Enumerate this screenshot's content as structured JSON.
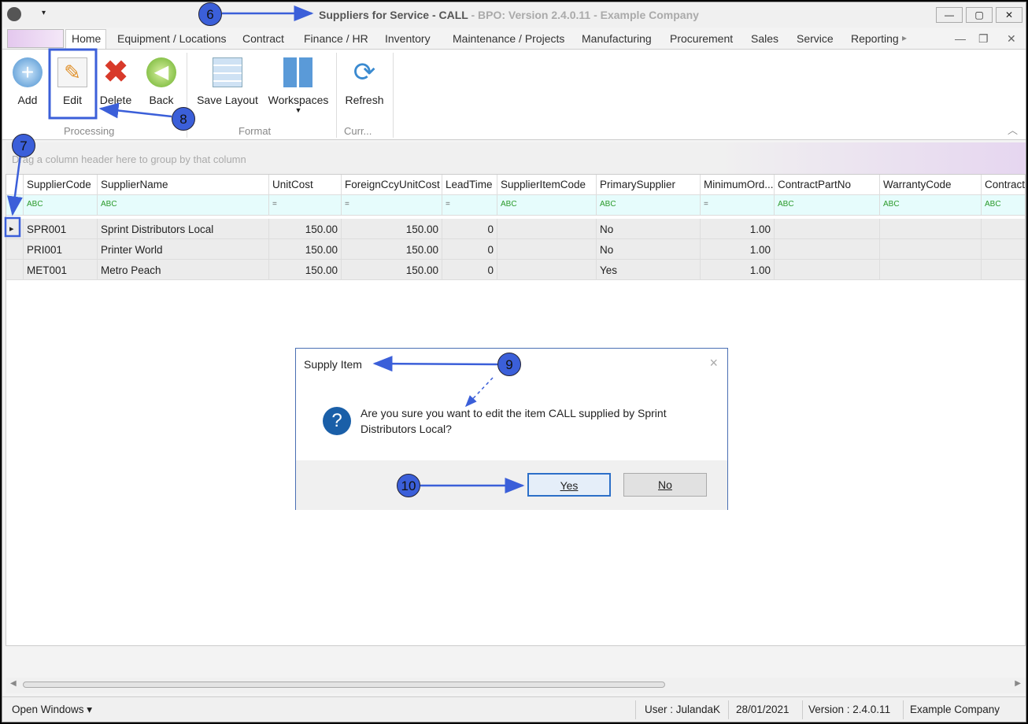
{
  "window": {
    "title": "Suppliers for Service - CALL",
    "subtitle": " - BPO: Version 2.4.0.11 - Example Company",
    "minimize": "—",
    "maximize": "▢",
    "close": "✕"
  },
  "tabs": [
    "Home",
    "Equipment / Locations",
    "Contract",
    "Finance / HR",
    "Inventory",
    "Maintenance / Projects",
    "Manufacturing",
    "Procurement",
    "Sales",
    "Service",
    "Reporting"
  ],
  "ribbon": {
    "buttons": {
      "add": "Add",
      "edit": "Edit",
      "delete": "Delete",
      "back": "Back",
      "save_layout": "Save Layout",
      "workspaces": "Workspaces",
      "refresh": "Refresh"
    },
    "groups": {
      "processing": "Processing",
      "format": "Format",
      "current": "Curr..."
    }
  },
  "grid": {
    "group_hint": "Drag a column header here to group by that column",
    "columns": [
      "SupplierCode",
      "SupplierName",
      "UnitCost",
      "ForeignCcyUnitCost",
      "LeadTime",
      "SupplierItemCode",
      "PrimarySupplier",
      "MinimumOrd...",
      "ContractPartNo",
      "WarrantyCode",
      "Contract"
    ],
    "filters": [
      "ABC",
      "ABC",
      "=",
      "=",
      "=",
      "ABC",
      "ABC",
      "=",
      "ABC",
      "ABC",
      "ABC"
    ],
    "rows": [
      [
        "SPR001",
        "Sprint Distributors Local",
        "150.00",
        "150.00",
        "0",
        "",
        "No",
        "1.00",
        "",
        "",
        ""
      ],
      [
        "PRI001",
        "Printer World",
        "150.00",
        "150.00",
        "0",
        "",
        "No",
        "1.00",
        "",
        "",
        ""
      ],
      [
        "MET001",
        "Metro Peach",
        "150.00",
        "150.00",
        "0",
        "",
        "Yes",
        "1.00",
        "",
        "",
        ""
      ]
    ]
  },
  "dialog": {
    "title": "Supply Item",
    "message": "Are you sure you want to edit the item CALL supplied by Sprint Distributors Local?",
    "yes": "Yes",
    "no": "No",
    "close": "×",
    "icon": "?"
  },
  "status": {
    "open_windows": "Open Windows ▾",
    "user": "User : JulandaK",
    "date": "28/01/2021",
    "version": "Version : 2.4.0.11",
    "company": "Example Company"
  },
  "annotations": [
    "6",
    "7",
    "8",
    "9",
    "10"
  ],
  "colors": {
    "annotation": "#3b5fd9",
    "accent": "#2c6fc8"
  }
}
